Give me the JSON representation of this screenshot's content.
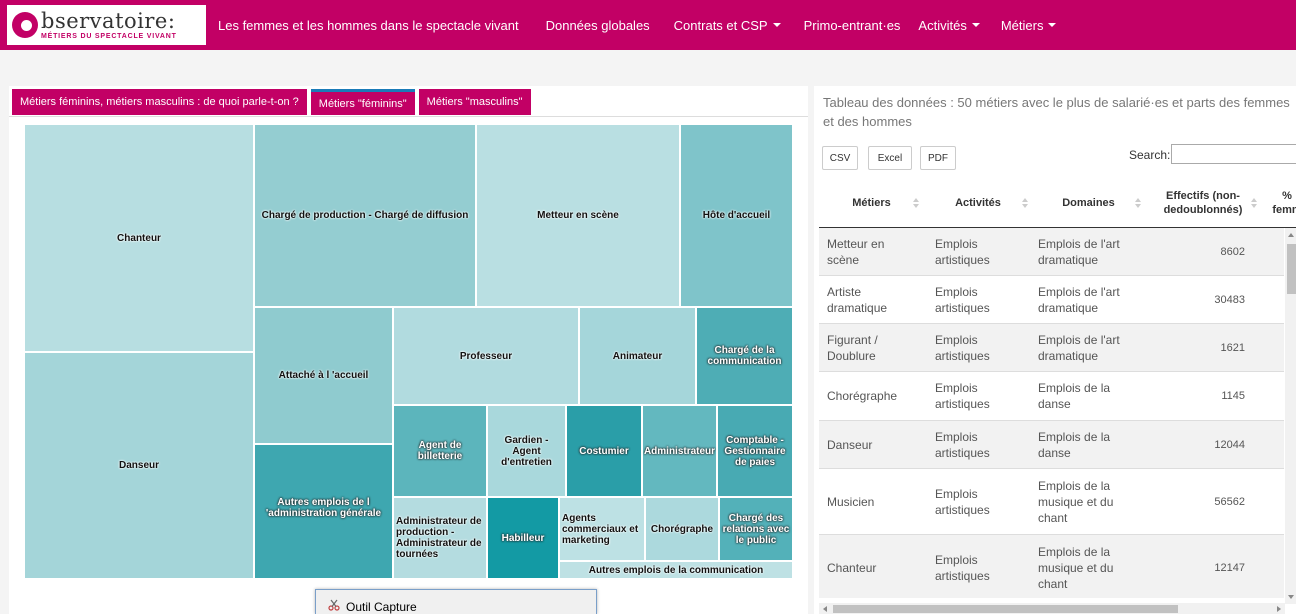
{
  "navbar": {
    "logo": {
      "main": "bservatoire:",
      "sub": "MÉTIERS DU SPECTACLE VIVANT"
    },
    "items": [
      {
        "label": "Les femmes et les hommes dans le spectacle vivant"
      },
      {
        "label": "Données globales"
      },
      {
        "label": "Contrats et CSP"
      },
      {
        "label": "Primo-entrant·es"
      },
      {
        "label": "Activités"
      },
      {
        "label": "Métiers"
      }
    ],
    "colors": {
      "brand": "#c20065"
    }
  },
  "tabs": [
    {
      "label": "Métiers féminins, métiers masculins : de quoi parle-t-on ?"
    },
    {
      "label": "Métiers \"féminins\""
    },
    {
      "label": "Métiers \"masculins\""
    }
  ],
  "treemap": {
    "cells": [
      {
        "label": "Chanteur"
      },
      {
        "label": "Danseur"
      },
      {
        "label": "Chargé de production - Chargé de diffusion"
      },
      {
        "label": "Metteur en scène"
      },
      {
        "label": "Hôte d'accueil"
      },
      {
        "label": "Attaché à l 'accueil"
      },
      {
        "label": "Autres emplois de l 'administration générale"
      },
      {
        "label": "Professeur"
      },
      {
        "label": "Animateur"
      },
      {
        "label": "Chargé de la communication"
      },
      {
        "label": "Agent de billetterie"
      },
      {
        "label": "Gardien - Agent d'entretien"
      },
      {
        "label": "Costumier"
      },
      {
        "label": "Administrateur"
      },
      {
        "label": "Comptable - Gestionnaire de paies"
      },
      {
        "label": "Administrateur de production - Administrateur de tournées"
      },
      {
        "label": "Habilleur"
      },
      {
        "label": "Agents commerciaux et marketing"
      },
      {
        "label": "Chorégraphe"
      },
      {
        "label": "Chargé des relations avec le public"
      },
      {
        "label": "Autres emplois de la communication"
      }
    ]
  },
  "table": {
    "title": "Tableau des données : 50 métiers avec le plus de salarié·es et parts des femmes et des hommes",
    "buttons": {
      "csv": "CSV",
      "excel": "Excel",
      "pdf": "PDF"
    },
    "search_label": "Search:",
    "search_value": "",
    "headers": {
      "metiers": "Métiers",
      "activites": "Activités",
      "domaines": "Domaines",
      "effectifs": "Effectifs (non-dedoublonnés)",
      "pct": "% femm"
    },
    "rows": [
      {
        "metier": "Metteur en scène",
        "activite": "Emplois artistiques",
        "domaine": "Emplois de l'art dramatique",
        "effectif": "8602"
      },
      {
        "metier": "Artiste dramatique",
        "activite": "Emplois artistiques",
        "domaine": "Emplois de l'art dramatique",
        "effectif": "30483"
      },
      {
        "metier": "Figurant / Doublure",
        "activite": "Emplois artistiques",
        "domaine": "Emplois de l'art dramatique",
        "effectif": "1621"
      },
      {
        "metier": "Chorégraphe",
        "activite": "Emplois artistiques",
        "domaine": "Emplois de la danse",
        "effectif": "1145"
      },
      {
        "metier": "Danseur",
        "activite": "Emplois artistiques",
        "domaine": "Emplois de la danse",
        "effectif": "12044"
      },
      {
        "metier": "Musicien",
        "activite": "Emplois artistiques",
        "domaine": "Emplois de la musique et du chant",
        "effectif": "56562"
      },
      {
        "metier": "Chanteur",
        "activite": "Emplois artistiques",
        "domaine": "Emplois de la musique et du chant",
        "effectif": "12147"
      }
    ]
  },
  "capture_window": {
    "title": "Outil Capture"
  }
}
